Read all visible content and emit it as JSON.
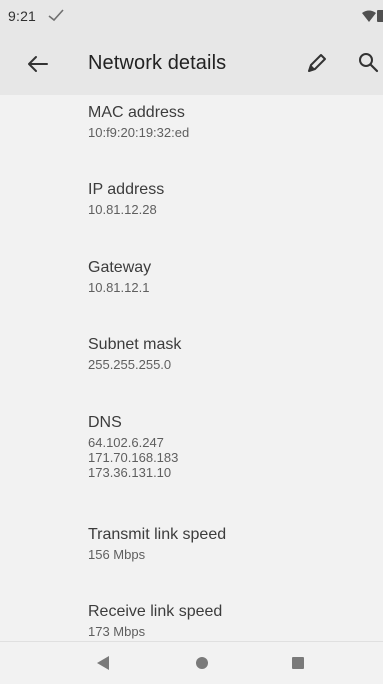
{
  "status_bar": {
    "time": "9:21"
  },
  "app_bar": {
    "title": "Network details",
    "icons": [
      "back-arrow-icon",
      "edit-pencil-icon",
      "search-icon"
    ]
  },
  "details": {
    "mac": {
      "label": "MAC address",
      "value": "10:f9:20:19:32:ed"
    },
    "ip": {
      "label": "IP address",
      "value": "10.81.12.28"
    },
    "gateway": {
      "label": "Gateway",
      "value": "10.81.12.1"
    },
    "subnet": {
      "label": "Subnet mask",
      "value": "255.255.255.0"
    },
    "dns": {
      "label": "DNS",
      "values": [
        "64.102.6.247",
        "171.70.168.183",
        "173.36.131.10"
      ]
    },
    "transmit": {
      "label": "Transmit link speed",
      "value": "156 Mbps"
    },
    "receive": {
      "label": "Receive link speed",
      "value": "173 Mbps"
    }
  },
  "colors": {
    "app_bar_bg": "#e7e7e7",
    "content_bg": "#f2f2f2",
    "nav_icon": "#7a7a7a"
  },
  "nav_bar": {
    "icons": [
      "nav-back-icon",
      "nav-home-icon",
      "nav-recents-icon"
    ]
  }
}
